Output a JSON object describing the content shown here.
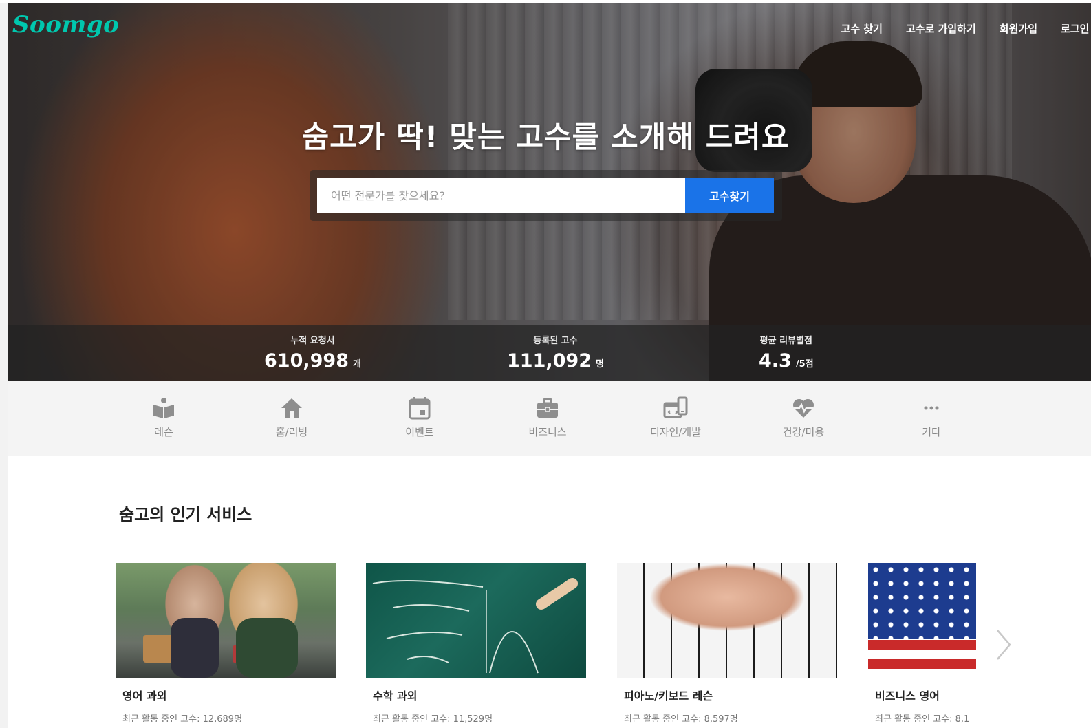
{
  "header": {
    "logo": "Soomgo",
    "nav": [
      "고수 찾기",
      "고수로 가입하기",
      "회원가입",
      "로그인"
    ]
  },
  "hero": {
    "headline": "숨고가 딱! 맞는 고수를 소개해 드려요",
    "search": {
      "placeholder": "어떤 전문가를 찾으세요?",
      "button": "고수찾기"
    },
    "stats": [
      {
        "label": "누적 요청서",
        "value": "610,998",
        "unit": "개"
      },
      {
        "label": "등록된 고수",
        "value": "111,092",
        "unit": "명"
      },
      {
        "label": "평균 리뷰별점",
        "value": "4.3",
        "unit": "/5점"
      }
    ]
  },
  "categories": [
    {
      "label": "레슨",
      "icon": "book-reader-icon"
    },
    {
      "label": "홈/리빙",
      "icon": "home-icon"
    },
    {
      "label": "이벤트",
      "icon": "calendar-icon"
    },
    {
      "label": "비즈니스",
      "icon": "briefcase-icon"
    },
    {
      "label": "디자인/개발",
      "icon": "design-dev-icon"
    },
    {
      "label": "건강/미용",
      "icon": "heart-pulse-icon"
    },
    {
      "label": "기타",
      "icon": "more-icon"
    }
  ],
  "popular": {
    "title": "숨고의 인기 서비스",
    "cards": [
      {
        "title": "영어 과외",
        "meta": "최근 활동 중인 고수: 12,689명"
      },
      {
        "title": "수학 과외",
        "meta": "최근 활동 중인 고수: 11,529명"
      },
      {
        "title": "피아노/키보드 레슨",
        "meta": "최근 활동 중인 고수: 8,597명"
      },
      {
        "title": "비즈니스 영어",
        "meta": "최근 활동 중인 고수: 8,1"
      }
    ]
  },
  "colors": {
    "brand": "#00c7ae",
    "primary": "#1a73e8"
  }
}
